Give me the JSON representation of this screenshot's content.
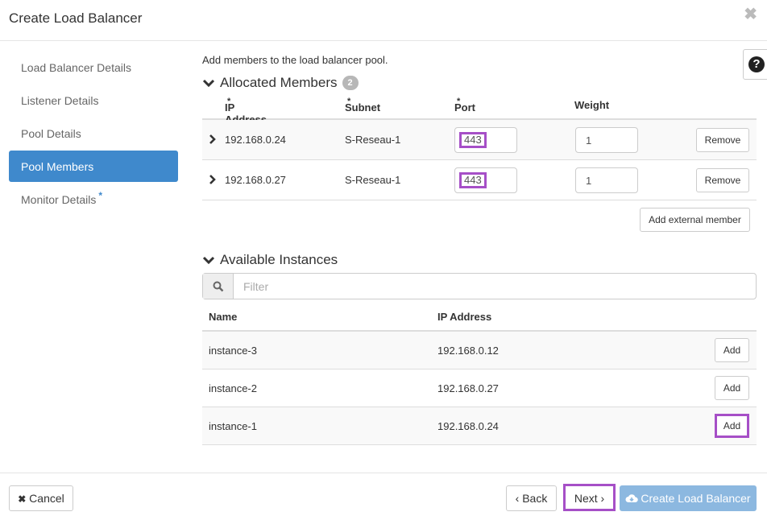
{
  "dialog": {
    "title": "Create Load Balancer",
    "close_icon": "close-icon"
  },
  "sidebar": {
    "items": [
      {
        "label": "Load Balancer Details",
        "active": false
      },
      {
        "label": "Listener Details",
        "active": false
      },
      {
        "label": "Pool Details",
        "active": false
      },
      {
        "label": "Pool Members",
        "active": true
      },
      {
        "label": "Monitor Details",
        "active": false,
        "required": "*"
      }
    ]
  },
  "help": {
    "icon": "question-circle-icon",
    "glyph": "?"
  },
  "main": {
    "intro": "Add members to the load balancer pool.",
    "allocated": {
      "title": "Allocated Members",
      "count": "2",
      "columns": {
        "ip": "IP Address",
        "subnet": "Subnet",
        "port": "Port",
        "weight": "Weight",
        "required_mark": "*"
      },
      "rows": [
        {
          "ip": "192.168.0.24",
          "subnet": "S-Reseau-1",
          "port": "443",
          "weight": "1",
          "remove_label": "Remove"
        },
        {
          "ip": "192.168.0.27",
          "subnet": "S-Reseau-1",
          "port": "443",
          "weight": "1",
          "remove_label": "Remove"
        }
      ],
      "add_external_label": "Add external member"
    },
    "available": {
      "title": "Available Instances",
      "filter_placeholder": "Filter",
      "columns": {
        "name": "Name",
        "ip": "IP Address"
      },
      "rows": [
        {
          "name": "instance-3",
          "ip": "192.168.0.12",
          "add_label": "Add"
        },
        {
          "name": "instance-2",
          "ip": "192.168.0.27",
          "add_label": "Add"
        },
        {
          "name": "instance-1",
          "ip": "192.168.0.24",
          "add_label": "Add"
        }
      ]
    }
  },
  "footer": {
    "cancel_label": "Cancel",
    "back_label": "‹ Back",
    "next_label": "Next ›",
    "create_label": "Create Load Balancer"
  },
  "colors": {
    "accent": "#3f89cc",
    "highlight": "#a64fc7",
    "create_disabled": "#8cb8e0"
  }
}
